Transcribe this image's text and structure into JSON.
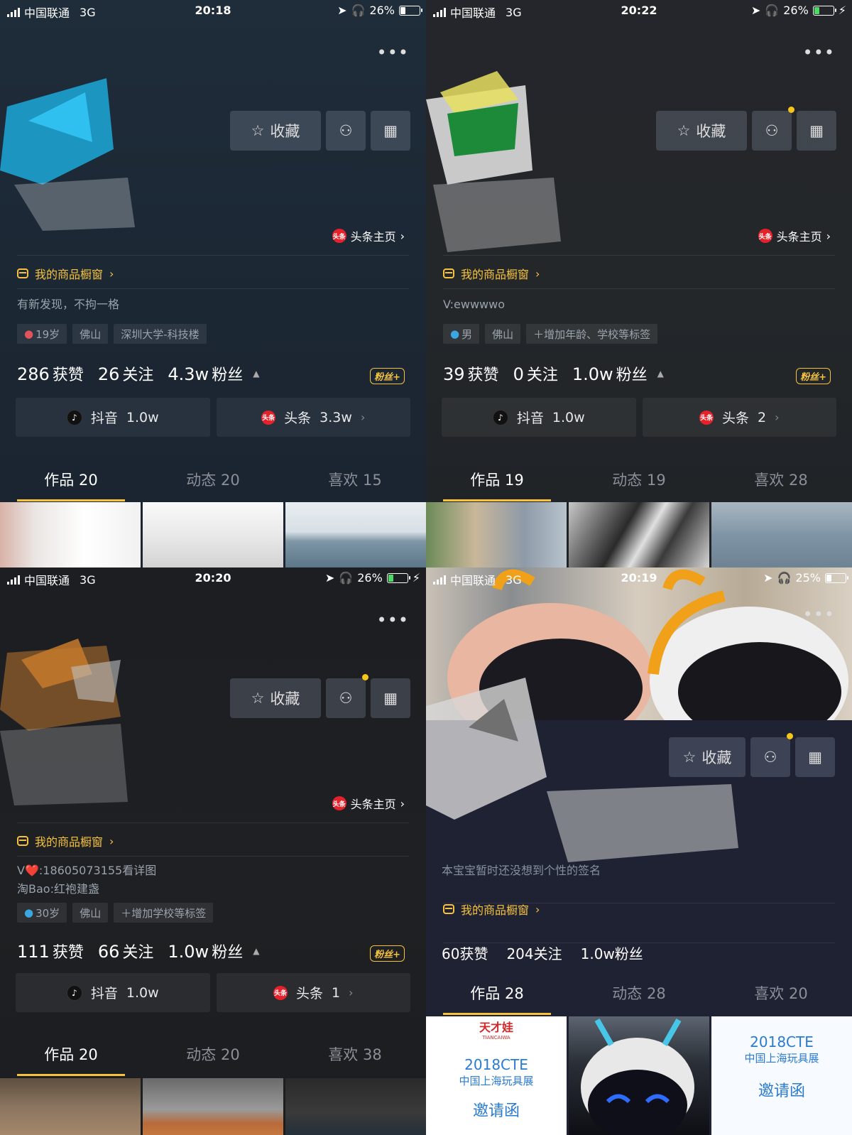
{
  "panels": [
    {
      "status": {
        "carrier": "中国联通",
        "network": "3G",
        "time": "20:18",
        "battery": "26%"
      },
      "fav_label": "收藏",
      "toutiao_link": "头条主页",
      "shop_label": "我的商品橱窗",
      "signature": [
        "有新发现，不拘一格"
      ],
      "tags": [
        "19岁",
        "佛山",
        "深圳大学-科技楼"
      ],
      "stats": {
        "likes": "286",
        "likes_label": "获赞",
        "following": "26",
        "following_label": "关注",
        "fans": "4.3w",
        "fans_label": "粉丝"
      },
      "fan_badge": "粉丝+",
      "platforms": [
        {
          "name": "抖音",
          "count": "1.0w"
        },
        {
          "name": "头条",
          "count": "3.3w"
        }
      ],
      "tabs": [
        "作品 20",
        "动态 20",
        "喜欢 15"
      ]
    },
    {
      "status": {
        "carrier": "中国联通",
        "network": "3G",
        "time": "20:22",
        "battery": "26%"
      },
      "fav_label": "收藏",
      "toutiao_link": "头条主页",
      "shop_label": "我的商品橱窗",
      "signature": [
        "V:ewwwwo"
      ],
      "tags": [
        "男",
        "佛山",
        "＋增加年龄、学校等标签"
      ],
      "stats": {
        "likes": "39",
        "likes_label": "获赞",
        "following": "0",
        "following_label": "关注",
        "fans": "1.0w",
        "fans_label": "粉丝"
      },
      "fan_badge": "粉丝+",
      "platforms": [
        {
          "name": "抖音",
          "count": "1.0w"
        },
        {
          "name": "头条",
          "count": "2"
        }
      ],
      "tabs": [
        "作品 19",
        "动态 19",
        "喜欢 28"
      ]
    },
    {
      "status": {
        "carrier": "中国联通",
        "network": "3G",
        "time": "20:20",
        "battery": "26%"
      },
      "fav_label": "收藏",
      "toutiao_link": "头条主页",
      "shop_label": "我的商品橱窗",
      "signature": [
        "V❤️:18605073155看详图",
        "淘Bao:红袍建盏"
      ],
      "tags": [
        "30岁",
        "佛山",
        "＋增加学校等标签"
      ],
      "stats": {
        "likes": "111",
        "likes_label": "获赞",
        "following": "66",
        "following_label": "关注",
        "fans": "1.0w",
        "fans_label": "粉丝"
      },
      "fan_badge": "粉丝+",
      "platforms": [
        {
          "name": "抖音",
          "count": "1.0w"
        },
        {
          "name": "头条",
          "count": "1"
        }
      ],
      "tabs": [
        "作品 20",
        "动态 20",
        "喜欢 38"
      ]
    },
    {
      "status": {
        "carrier": "中国联通",
        "network": "3G",
        "time": "20:19",
        "battery": "25%"
      },
      "fav_label": "收藏",
      "signature": [
        "本宝宝暂时还没想到个性的签名"
      ],
      "shop_label": "我的商品橱窗",
      "stats_text": {
        "likes": "60获赞",
        "following": "204关注",
        "fans": "1.0w粉丝"
      },
      "tabs": [
        "作品 28",
        "动态 28",
        "喜欢 20"
      ],
      "thumb_texts": {
        "brand": "天才娃",
        "brand_en": "TIANCAIWA",
        "event": "2018CTE",
        "event_sub": "中国上海玩具展",
        "invite": "邀请函"
      }
    }
  ],
  "icons": {
    "star": "star-icon",
    "add_user": "add-user-icon",
    "qr": "qr-code-icon",
    "more": "more-icon",
    "douyin": "douyin-icon",
    "toutiao": "toutiao-icon",
    "shop": "shop-icon"
  },
  "colors": {
    "accent": "#f6c23e",
    "toutiao_red": "#e5222b",
    "battery_green": "#4cd964"
  }
}
